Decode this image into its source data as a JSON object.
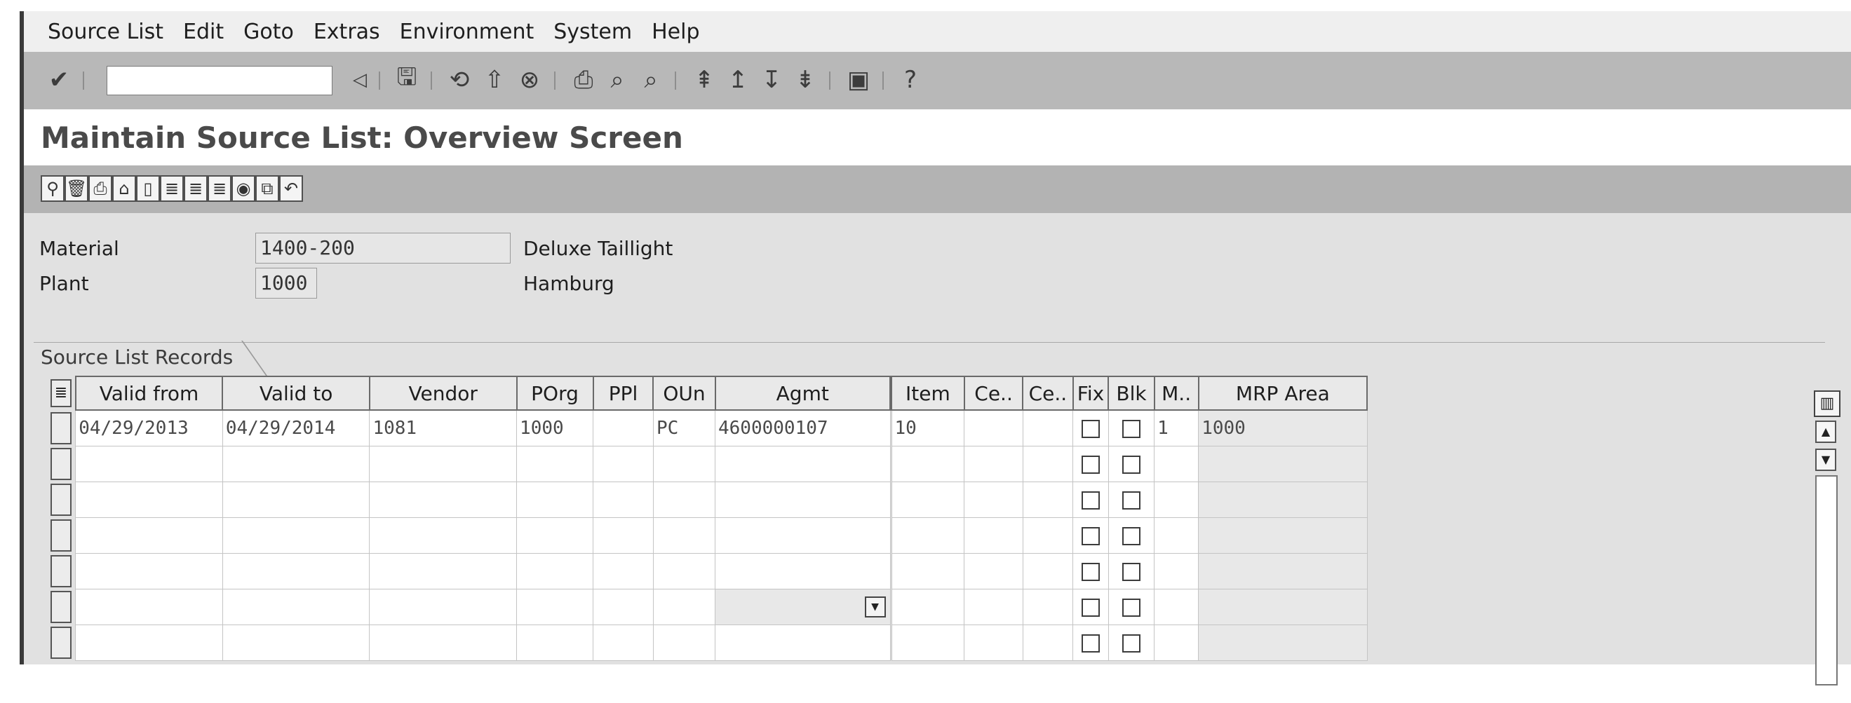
{
  "menu": {
    "items": [
      "Source List",
      "Edit",
      "Goto",
      "Extras",
      "Environment",
      "System",
      "Help"
    ]
  },
  "toolbar": {
    "command_value": "",
    "icons": [
      "enter-icon",
      "back-arrow-icon",
      "save-icon",
      "back-icon",
      "exit-icon",
      "cancel-icon",
      "print-icon",
      "find-icon",
      "find-next-icon",
      "first-page-icon",
      "previous-page-icon",
      "next-page-icon",
      "last-page-icon",
      "create-session-icon",
      "help-icon"
    ]
  },
  "title": "Maintain Source List: Overview Screen",
  "app_toolbar": {
    "icons": [
      "select-all-icon",
      "delete-icon",
      "print-icon",
      "layout-icon",
      "new-entry-icon",
      "generate-records-icon",
      "copy-records-icon",
      "detail-icon",
      "globe-icon",
      "copy-icon",
      "undo-icon"
    ]
  },
  "header": {
    "material_label": "Material",
    "material_value": "1400-200",
    "material_desc": "Deluxe Taillight",
    "plant_label": "Plant",
    "plant_value": "1000",
    "plant_desc": "Hamburg"
  },
  "table": {
    "tab_label": "Source List Records",
    "columns_left": [
      "Valid from",
      "Valid to",
      "Vendor",
      "POrg",
      "PPl",
      "OUn",
      "Agmt"
    ],
    "columns_right": [
      "Item",
      "Ce..",
      "Ce..",
      "Fix",
      "Blk",
      "M..",
      "MRP Area"
    ],
    "rows": [
      {
        "valid_from": "04/29/2013",
        "valid_to": "04/29/2014",
        "vendor": "1081",
        "porg": "1000",
        "ppl": "",
        "oun": "PC",
        "agmt": "4600000107",
        "item": "10",
        "ce1": "",
        "ce2": "",
        "m": "1",
        "mrp_area": "1000"
      }
    ]
  }
}
